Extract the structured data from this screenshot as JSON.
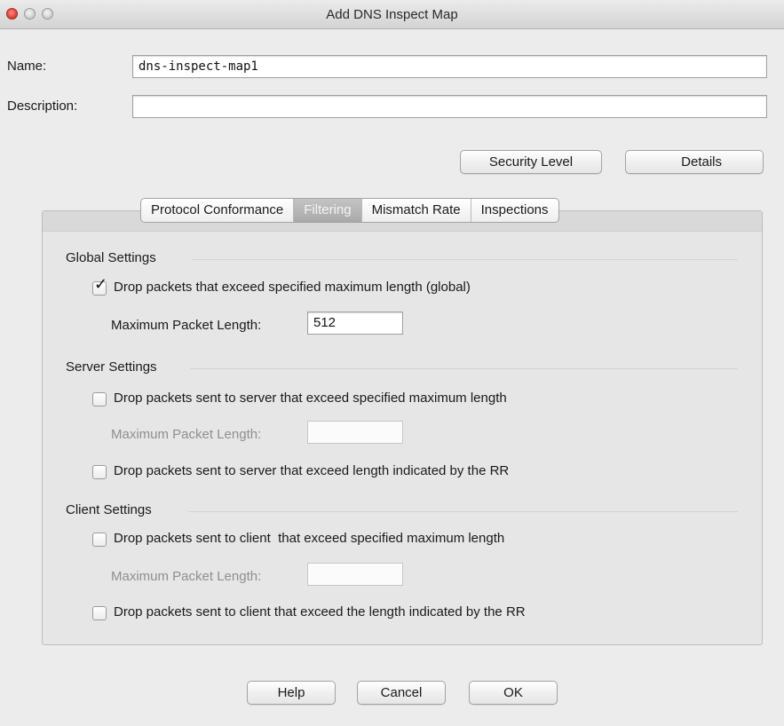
{
  "window": {
    "title": "Add DNS Inspect Map"
  },
  "form": {
    "name_label": "Name:",
    "name_value": "dns-inspect-map1",
    "description_label": "Description:",
    "description_value": ""
  },
  "buttons": {
    "security_level": "Security Level",
    "details": "Details",
    "help": "Help",
    "cancel": "Cancel",
    "ok": "OK"
  },
  "tabs": [
    {
      "label": "Protocol Conformance",
      "active": false
    },
    {
      "label": "Filtering",
      "active": true
    },
    {
      "label": "Mismatch Rate",
      "active": false
    },
    {
      "label": "Inspections",
      "active": false
    }
  ],
  "global": {
    "heading": "Global Settings",
    "drop_label": "Drop packets that exceed specified maximum length (global)",
    "drop_checked": true,
    "max_len_label": "Maximum Packet Length:",
    "max_len_value": "512"
  },
  "server": {
    "heading": "Server Settings",
    "drop_label": "Drop packets sent to server that exceed specified maximum length",
    "drop_checked": false,
    "max_len_label": "Maximum Packet Length:",
    "max_len_value": "",
    "drop_rr_label": "Drop packets sent to server that exceed length indicated by the RR",
    "drop_rr_checked": false
  },
  "client": {
    "heading": "Client Settings",
    "drop_label": "Drop packets sent to client  that exceed specified maximum length",
    "drop_checked": false,
    "max_len_label": "Maximum Packet Length:",
    "max_len_value": "",
    "drop_rr_label": "Drop packets sent to client that exceed the length indicated by the RR",
    "drop_rr_checked": false
  },
  "icons": {
    "close": "close-window-icon",
    "minimize": "minimize-window-icon",
    "zoom": "zoom-window-icon",
    "checkmark": "checkmark-icon"
  }
}
